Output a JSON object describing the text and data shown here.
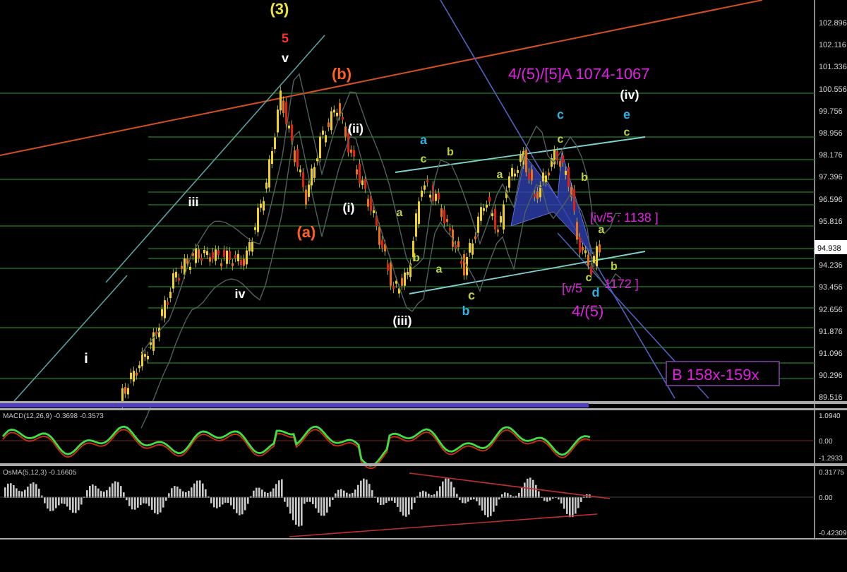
{
  "price_chart": {
    "wave_labels": [
      {
        "text": "(3)",
        "color": "#e8e040"
      },
      {
        "text": "5",
        "color": "#ff3030"
      },
      {
        "text": "v",
        "color": "#ffffff"
      },
      {
        "text": "(b)",
        "color": "#ff6020"
      },
      {
        "text": "(iv)",
        "color": "#ffffff"
      },
      {
        "text": "c",
        "color": "#30b0e0"
      },
      {
        "text": "e",
        "color": "#30b0e0"
      },
      {
        "text": "(ii)",
        "color": "#ffffff"
      },
      {
        "text": "c",
        "color": "#c0d040"
      },
      {
        "text": "c",
        "color": "#c0d040"
      },
      {
        "text": "a",
        "color": "#30b0e0"
      },
      {
        "text": "b",
        "color": "#c0d040"
      },
      {
        "text": "c",
        "color": "#c0d040"
      },
      {
        "text": "a",
        "color": "#c0d040"
      },
      {
        "text": "b",
        "color": "#c0d040"
      },
      {
        "text": "iii",
        "color": "#ffffff"
      },
      {
        "text": "(i)",
        "color": "#ffffff"
      },
      {
        "text": "a",
        "color": "#c0d040"
      },
      {
        "text": "a",
        "color": "#c0d040"
      },
      {
        "text": "(a)",
        "color": "#ff6020"
      },
      {
        "text": "b",
        "color": "#c0d040"
      },
      {
        "text": "b",
        "color": "#c0d040"
      },
      {
        "text": "a",
        "color": "#c0d040"
      },
      {
        "text": "c",
        "color": "#c0d040"
      },
      {
        "text": "iv",
        "color": "#ffffff"
      },
      {
        "text": "c",
        "color": "#c0d040"
      },
      {
        "text": "d",
        "color": "#30b0e0"
      },
      {
        "text": "b",
        "color": "#30b0e0"
      },
      {
        "text": "(iii)",
        "color": "#ffffff"
      },
      {
        "text": "i",
        "color": "#ffffff"
      }
    ],
    "annotations": [
      {
        "text": "4/(5)/[5]A 1074-1067",
        "color": "#e020e0"
      },
      {
        "text": "[iv/5 : 1138 ]",
        "color": "#e020e0"
      },
      {
        "text": "[v/5",
        "color": "#e020e0"
      },
      {
        "text": "1172 ]",
        "color": "#e020e0"
      },
      {
        "text": "4/(5)",
        "color": "#e020e0"
      }
    ],
    "target_box": {
      "text": "B 158x-159x"
    },
    "price_axis": {
      "labels": [
        "102.896",
        "102.116",
        "101.336",
        "100.556",
        "99.756",
        "98.956",
        "98.176",
        "97.396",
        "96.596",
        "95.816",
        "94.236",
        "93.456",
        "92.656",
        "91.876",
        "91.096",
        "90.296",
        "89.516"
      ],
      "current_price": "94.938"
    }
  },
  "macd_panel": {
    "title": "MACD(12,26,9) -0.3698 -0.3573",
    "axis_labels": [
      "1.0940",
      "0.00",
      "-1.2933"
    ]
  },
  "osma_panel": {
    "title": "OsMA(5,12,3) -0.16605",
    "axis_labels": [
      "0.31775",
      "0.00",
      "-0.42309"
    ]
  }
}
